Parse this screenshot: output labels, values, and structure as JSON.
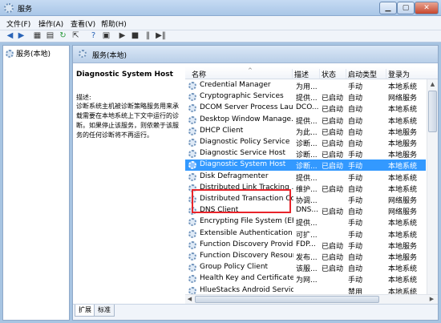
{
  "window": {
    "title": "服务"
  },
  "menu": [
    "文件(F)",
    "操作(A)",
    "查看(V)",
    "帮助(H)"
  ],
  "toolbar_icons": [
    "back-icon",
    "forward-icon",
    "console-tree-icon",
    "list-icon",
    "refresh-icon",
    "export-icon",
    "help-icon",
    "properties-icon",
    "play-icon",
    "stop-icon",
    "pause-icon",
    "restart-icon"
  ],
  "tree": {
    "root": "服务(本地)"
  },
  "panel": {
    "header": "服务(本地)"
  },
  "details": {
    "service_name": "Diagnostic System Host",
    "desc_label": "描述:",
    "desc_text": "诊断系统主机被诊断策略服务用来承载需要在本地系统上下文中运行的诊断。如果停止该服务，则依赖于该服务的任何诊断将不再运行。"
  },
  "columns": {
    "name": "名称",
    "desc": "描述",
    "status": "状态",
    "startup": "启动类型",
    "logon": "登录为"
  },
  "services": [
    {
      "name": "Credential Manager",
      "desc": "为用...",
      "status": "",
      "startup": "手动",
      "logon": "本地系统"
    },
    {
      "name": "Cryptographic Services",
      "desc": "提供...",
      "status": "已启动",
      "startup": "自动",
      "logon": "网络服务"
    },
    {
      "name": "DCOM Server Process Lau...",
      "desc": "DCO...",
      "status": "已启动",
      "startup": "自动",
      "logon": "本地系统"
    },
    {
      "name": "Desktop Window Manage...",
      "desc": "提供...",
      "status": "已启动",
      "startup": "自动",
      "logon": "本地系统"
    },
    {
      "name": "DHCP Client",
      "desc": "为此...",
      "status": "已启动",
      "startup": "自动",
      "logon": "本地服务"
    },
    {
      "name": "Diagnostic Policy Service",
      "desc": "诊断...",
      "status": "已启动",
      "startup": "自动",
      "logon": "本地服务"
    },
    {
      "name": "Diagnostic Service Host",
      "desc": "诊断...",
      "status": "已启动",
      "startup": "手动",
      "logon": "本地服务"
    },
    {
      "name": "Diagnostic System Host",
      "desc": "诊断...",
      "status": "已启动",
      "startup": "手动",
      "logon": "本地系统"
    },
    {
      "name": "Disk Defragmenter",
      "desc": "提供...",
      "status": "",
      "startup": "手动",
      "logon": "本地系统"
    },
    {
      "name": "Distributed Link Tracking ...",
      "desc": "维护...",
      "status": "已启动",
      "startup": "自动",
      "logon": "本地系统"
    },
    {
      "name": "Distributed Transaction Co...",
      "desc": "协调...",
      "status": "",
      "startup": "手动",
      "logon": "网络服务"
    },
    {
      "name": "DNS Client",
      "desc": "DNS...",
      "status": "已启动",
      "startup": "自动",
      "logon": "网络服务"
    },
    {
      "name": "Encrypting File System (EFS)",
      "desc": "提供...",
      "status": "",
      "startup": "手动",
      "logon": "本地系统"
    },
    {
      "name": "Extensible Authentication P...",
      "desc": "可扩...",
      "status": "",
      "startup": "手动",
      "logon": "本地系统"
    },
    {
      "name": "Function Discovery Provide...",
      "desc": "FDP...",
      "status": "已启动",
      "startup": "手动",
      "logon": "本地服务"
    },
    {
      "name": "Function Discovery Resour...",
      "desc": "发布...",
      "status": "已启动",
      "startup": "自动",
      "logon": "本地服务"
    },
    {
      "name": "Group Policy Client",
      "desc": "该服...",
      "status": "已启动",
      "startup": "自动",
      "logon": "本地系统"
    },
    {
      "name": "Health Key and Certificate ...",
      "desc": "为网...",
      "status": "",
      "startup": "手动",
      "logon": "本地系统"
    },
    {
      "name": "HlueStacks Android Service",
      "desc": "",
      "status": "",
      "startup": "禁用",
      "logon": "本地系统"
    }
  ],
  "selected_service": "Diagnostic System Host",
  "tabs": [
    "扩展",
    "标准"
  ],
  "colors": {
    "selection": "#3399ff",
    "highlight_box": "#e8242a",
    "chrome": "#a7c4e2"
  }
}
